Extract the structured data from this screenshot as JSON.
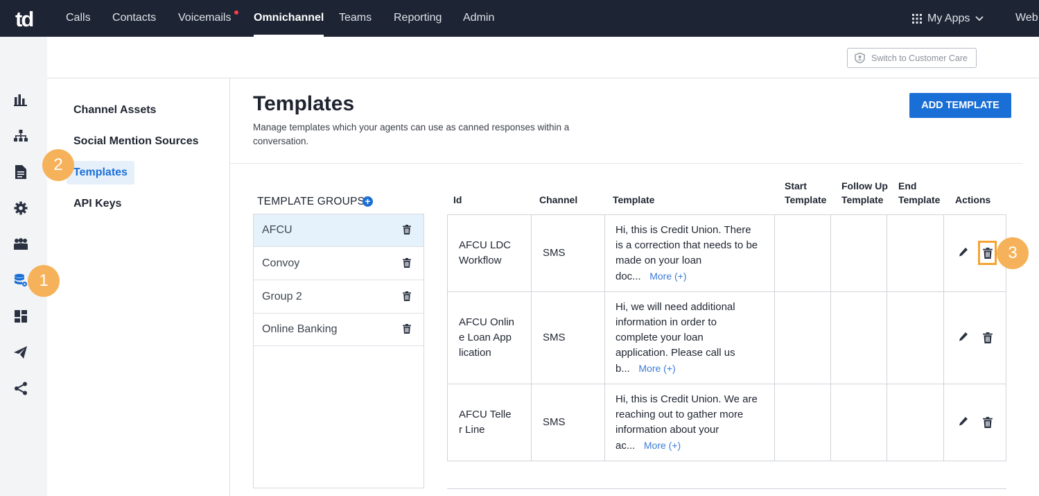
{
  "app": {
    "logo": "td"
  },
  "nav": {
    "items": [
      "Calls",
      "Contacts",
      "Voicemails",
      "Omnichannel",
      "Teams",
      "Reporting",
      "Admin"
    ],
    "active": "Omnichannel",
    "my_apps": "My Apps",
    "web": "Web"
  },
  "header": {
    "switch_label": "Switch to Customer Care"
  },
  "side_menu": {
    "items": [
      "Channel Assets",
      "Social Mention Sources",
      "Templates",
      "API Keys"
    ],
    "active": "Templates"
  },
  "page": {
    "title": "Templates",
    "subtitle": "Manage templates which your agents can use as canned responses within a conversation.",
    "add_button": "ADD TEMPLATE"
  },
  "groups": {
    "title": "TEMPLATE GROUPS",
    "items": [
      "AFCU",
      "Convoy",
      "Group 2",
      "Online Banking"
    ],
    "selected": "AFCU"
  },
  "table": {
    "headers": {
      "id": "Id",
      "channel": "Channel",
      "template": "Template",
      "start_1": "Start",
      "start_2": "Template",
      "follow_1": "Follow Up",
      "follow_2": "Template",
      "end_1": "End",
      "end_2": "Template",
      "actions": "Actions"
    },
    "more_label": "More (+)",
    "rows": [
      {
        "id_lines": [
          "AFCU LDC",
          "Workflow"
        ],
        "channel": "SMS",
        "template_lines": [
          "Hi, this is Credit Union. There",
          "is a correction that needs to be",
          "made on your loan",
          "doc..."
        ]
      },
      {
        "id_lines": [
          "AFCU Onlin",
          "e Loan App",
          "lication"
        ],
        "channel": "SMS",
        "template_lines": [
          "Hi, we will need additional",
          "information in order to",
          "complete your loan",
          "application. Please call us",
          "b..."
        ]
      },
      {
        "id_lines": [
          "AFCU Telle",
          "r Line"
        ],
        "channel": "SMS",
        "template_lines": [
          "Hi, this is Credit Union. We are",
          "reaching out to gather more",
          "information about your",
          "ac..."
        ]
      }
    ]
  },
  "annotations": {
    "badge_1": "1",
    "badge_2": "2",
    "badge_3": "3"
  },
  "colors": {
    "topbar": "#1d2433",
    "accent": "#1a6fd6",
    "badge": "#f6b25a"
  }
}
